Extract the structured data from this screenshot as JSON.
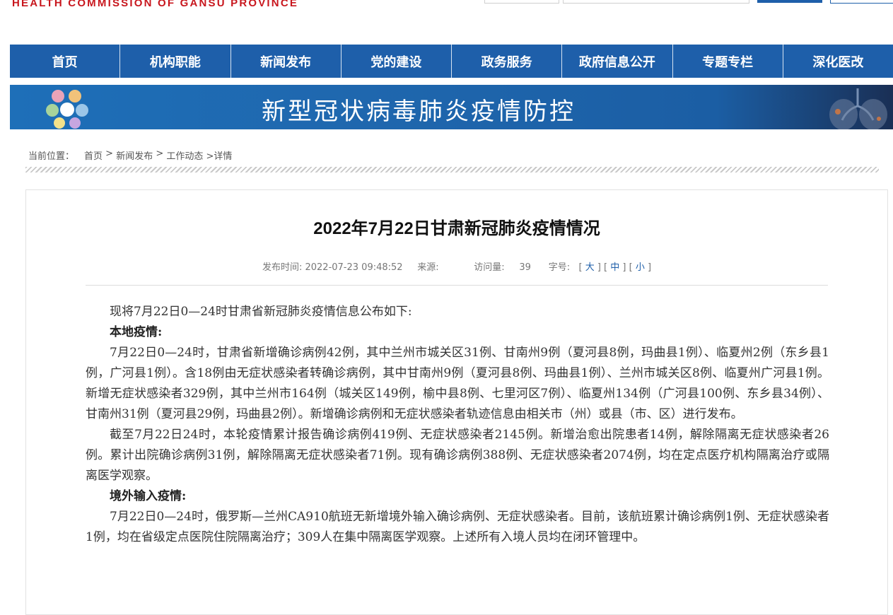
{
  "header": {
    "site_name_en": "HEALTH  COMMISSION  OF  GANSU PROVINCE"
  },
  "nav": {
    "items": [
      {
        "label": "首页"
      },
      {
        "label": "机构职能"
      },
      {
        "label": "新闻发布"
      },
      {
        "label": "党的建设"
      },
      {
        "label": "政务服务"
      },
      {
        "label": "政府信息公开"
      },
      {
        "label": "专题专栏"
      },
      {
        "label": "深化医改"
      }
    ]
  },
  "banner": {
    "title": "新型冠状病毒肺炎疫情防控"
  },
  "breadcrumb": {
    "prefix": "当前位置：",
    "home": "首页",
    "sep1": " > ",
    "news": "新闻发布",
    "sep2": " > ",
    "work": "工作动态",
    "tail": " >详情"
  },
  "article": {
    "title": "2022年7月22日甘肃新冠肺炎疫情情况",
    "meta": {
      "publish_label": "发布时间:",
      "publish_time": "2022-07-23 09:48:52",
      "source_label": "来源:",
      "views_label": "访问量:",
      "views": "39",
      "fontsize_label": "字号:",
      "size_large": "大",
      "size_medium": "中",
      "size_small": "小"
    },
    "intro": "现将7月22日0—24时甘肃省新冠肺炎疫情信息公布如下:",
    "local_heading": "本地疫情:",
    "local_p1": "7月22日0—24时，甘肃省新增确诊病例42例，其中兰州市城关区31例、甘南州9例（夏河县8例，玛曲县1例）、临夏州2例（东乡县1例，广河县1例）。含18例由无症状感染者转确诊病例，其中甘南州9例（夏河县8例、玛曲县1例）、兰州市城关区8例、临夏州广河县1例。新增无症状感染者329例，其中兰州市164例（城关区149例，榆中县8例、七里河区7例）、临夏州134例（广河县100例、东乡县34例）、甘南州31例（夏河县29例，玛曲县2例）。新增确诊病例和无症状感染者轨迹信息由相关市（州）或县（市、区）进行发布。",
    "local_p2": "截至7月22日24时，本轮疫情累计报告确诊病例419例、无症状感染者2145例。新增治愈出院患者14例，解除隔离无症状感染者26例。累计出院确诊病例31例，解除隔离无症状感染者71例。现有确诊病例388例、无症状感染者2074例，均在定点医疗机构隔离治疗或隔离医学观察。",
    "import_heading": "境外输入疫情:",
    "import_p1": "7月22日0—24时，俄罗斯—兰州CA910航班无新增境外输入确诊病例、无症状感染者。目前，该航班累计确诊病例1例、无症状感染者1例，均在省级定点医院住院隔离治疗；309人在集中隔离医学观察。上述所有入境人员均在闭环管理中。"
  }
}
